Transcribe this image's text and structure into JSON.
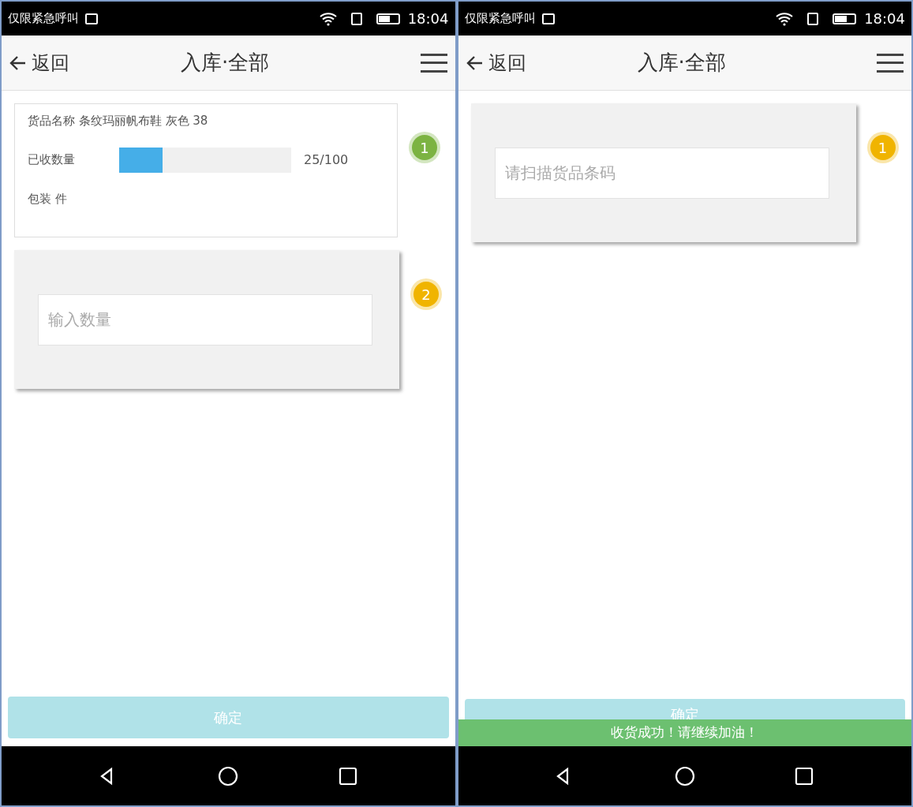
{
  "screens": [
    {
      "status_bar": {
        "notice": "仅限紧急呼叫",
        "time": "18:04"
      },
      "header": {
        "back": "返回",
        "title": "入库·全部"
      },
      "steps": [
        {
          "kind": "info",
          "number": "1",
          "color": "#7cb342",
          "name_label": "货品名称 条纹玛丽帆布鞋 灰色 38",
          "received_label": "已收数量",
          "level": 0.25,
          "reading": "25/100",
          "package_label": "包装 件"
        },
        {
          "kind": "input",
          "number": "2",
          "color": "#f0b400",
          "placeholder": "输入数量"
        }
      ],
      "confirm_button": "确定"
    },
    {
      "status_bar": {
        "notice": "仅限紧急呼叫",
        "time": "18:04"
      },
      "header": {
        "back": "返回",
        "title": "入库·全部"
      },
      "steps": [
        {
          "kind": "input",
          "number": "1",
          "color": "#f0b400",
          "placeholder": "请扫描货品条码"
        }
      ],
      "confirm_button": "确定",
      "toast": "收货成功！请继续加油！"
    }
  ]
}
